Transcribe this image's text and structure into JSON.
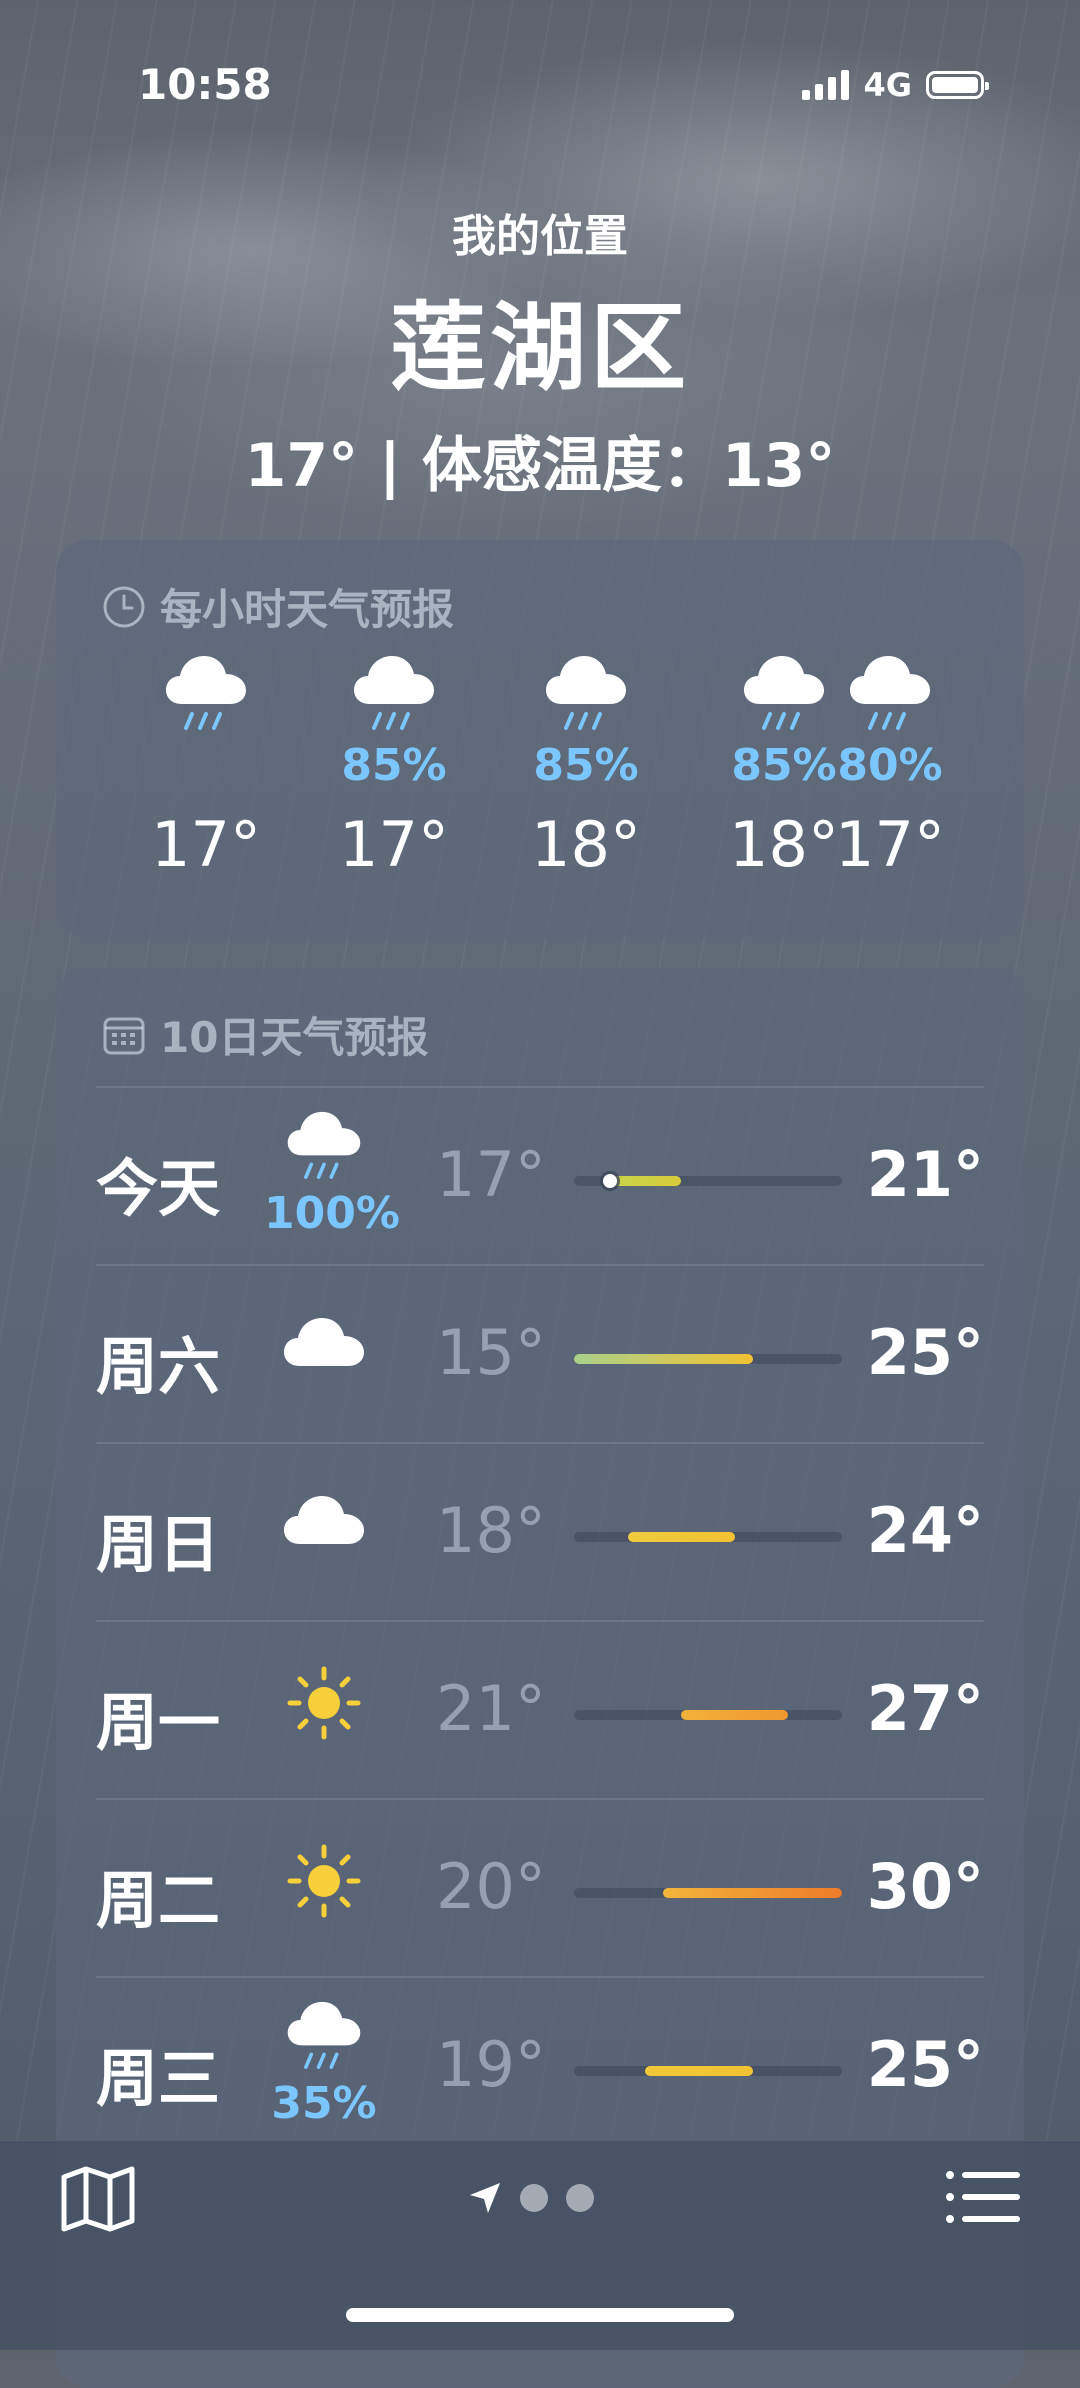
{
  "status_bar": {
    "time": "10:58",
    "network": "4G"
  },
  "header": {
    "location_label": "我的位置",
    "city": "莲湖区",
    "temp_line": "17° | 体感温度：13°"
  },
  "hourly": {
    "title": "每小时天气预报",
    "icons": [
      "rain-cloud-icon",
      "rain-cloud-icon",
      "rain-cloud-icon",
      "rain-cloud-icon",
      "rain-cloud-icon"
    ],
    "items": [
      {
        "pop": "",
        "temp": "17°"
      },
      {
        "pop": "85%",
        "temp": "17°"
      },
      {
        "pop": "85%",
        "temp": "18°"
      },
      {
        "pop": "85%",
        "temp": "18°"
      },
      {
        "pop": "80%",
        "temp": "17°"
      }
    ]
  },
  "daily": {
    "title": "10日天气预报",
    "range_min": 15,
    "range_max": 30,
    "current_temp": 17,
    "days": [
      {
        "day": "今天",
        "icon": "rain-cloud-icon",
        "pop": "100%",
        "low": "17°",
        "high": "21°",
        "low_v": 17,
        "high_v": 21,
        "colors": [
          "#c8d44a",
          "#d8cc3a"
        ]
      },
      {
        "day": "周六",
        "icon": "cloud-icon",
        "pop": "",
        "low": "15°",
        "high": "25°",
        "low_v": 15,
        "high_v": 25,
        "colors": [
          "#a9d08a",
          "#f1c232"
        ]
      },
      {
        "day": "周日",
        "icon": "cloud-icon",
        "pop": "",
        "low": "18°",
        "high": "24°",
        "low_v": 18,
        "high_v": 24,
        "colors": [
          "#f0cc3e",
          "#f2c232"
        ]
      },
      {
        "day": "周一",
        "icon": "sun-icon",
        "pop": "",
        "low": "21°",
        "high": "27°",
        "low_v": 21,
        "high_v": 27,
        "colors": [
          "#f2b23a",
          "#f0982e"
        ]
      },
      {
        "day": "周二",
        "icon": "sun-icon",
        "pop": "",
        "low": "20°",
        "high": "30°",
        "low_v": 20,
        "high_v": 30,
        "colors": [
          "#f2b53a",
          "#ee7b2a"
        ]
      },
      {
        "day": "周三",
        "icon": "rain-cloud-icon",
        "pop": "35%",
        "low": "19°",
        "high": "25°",
        "low_v": 19,
        "high_v": 25,
        "colors": [
          "#f2c93a",
          "#f1c232"
        ]
      }
    ]
  },
  "colors": {
    "precip": "#7cc6ff"
  }
}
